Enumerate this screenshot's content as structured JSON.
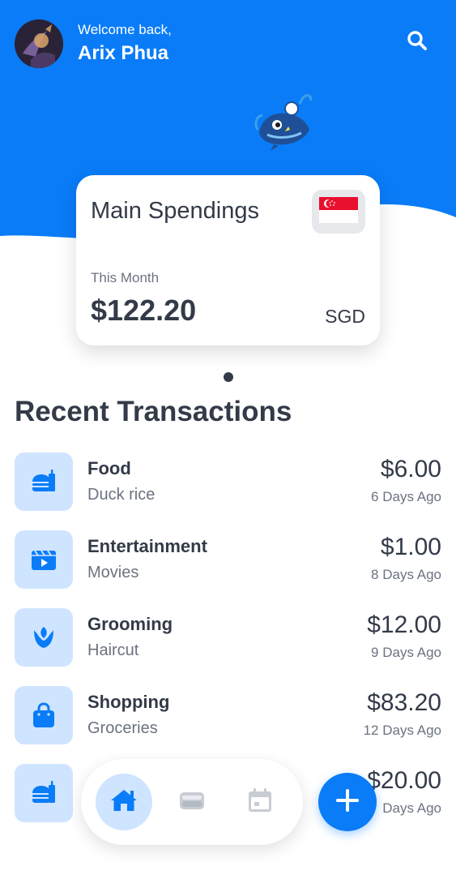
{
  "header": {
    "welcome_text": "Welcome back,",
    "user_name": "Arix Phua",
    "accent_color": "#0a7cf8",
    "search_icon": "search-icon"
  },
  "card": {
    "title": "Main Spendings",
    "period_label": "This Month",
    "amount": "$122.20",
    "currency": "SGD",
    "flag_icon": "singapore-flag-icon"
  },
  "pagination": {
    "pages": 1,
    "active": 1
  },
  "transactions_section": {
    "title": "Recent Transactions",
    "items": [
      {
        "category": "Food",
        "description": "Duck rice",
        "amount": "$6.00",
        "time": "6 Days Ago",
        "icon": "food-icon"
      },
      {
        "category": "Entertainment",
        "description": "Movies",
        "amount": "$1.00",
        "time": "8 Days Ago",
        "icon": "film-icon"
      },
      {
        "category": "Grooming",
        "description": "Haircut",
        "amount": "$12.00",
        "time": "9 Days Ago",
        "icon": "tulip-icon"
      },
      {
        "category": "Shopping",
        "description": "Groceries",
        "amount": "$83.20",
        "time": "12 Days Ago",
        "icon": "shopping-bag-icon"
      },
      {
        "category": "",
        "description": "",
        "amount": "$20.00",
        "time": "Days Ago",
        "icon": "food-icon"
      }
    ]
  },
  "nav": {
    "items": [
      {
        "name": "home",
        "icon": "home-icon",
        "active": true
      },
      {
        "name": "wallet",
        "icon": "wallet-icon",
        "active": false
      },
      {
        "name": "calendar",
        "icon": "calendar-icon",
        "active": false
      }
    ],
    "fab_icon": "plus-icon"
  }
}
